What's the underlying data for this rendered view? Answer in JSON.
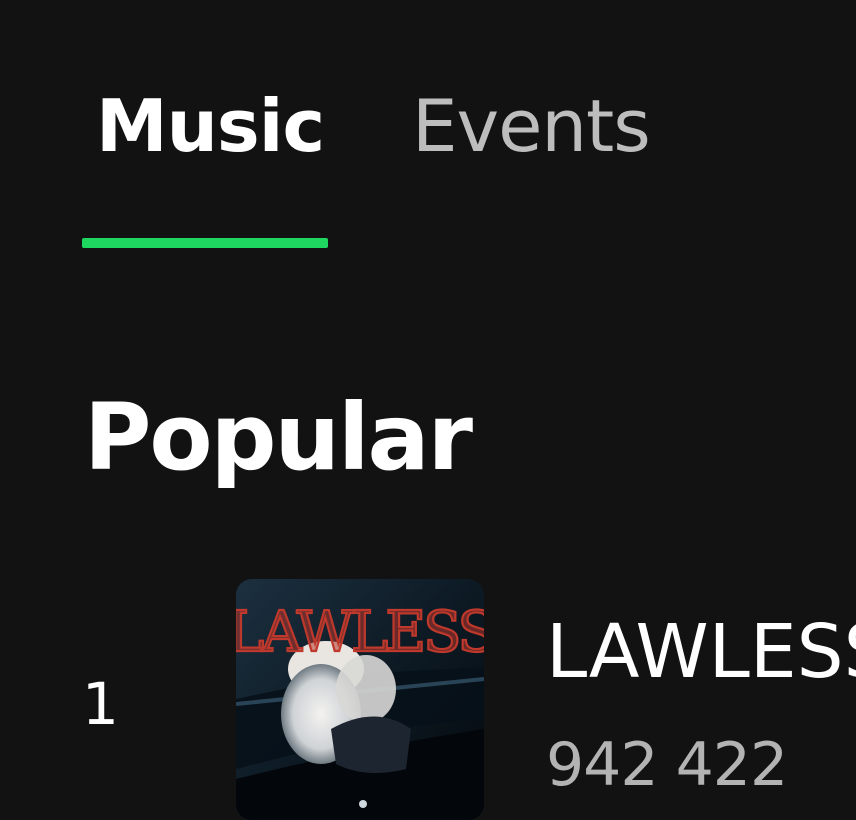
{
  "tabs": [
    {
      "label": "Music",
      "active": true
    },
    {
      "label": "Events",
      "active": false
    }
  ],
  "colors": {
    "accent": "#1ed760",
    "background": "#121212"
  },
  "section": {
    "title": "Popular"
  },
  "tracks": [
    {
      "rank": "1",
      "title": "LAWLESS",
      "plays": "942 422",
      "cover_text": "LAWLESS"
    }
  ]
}
